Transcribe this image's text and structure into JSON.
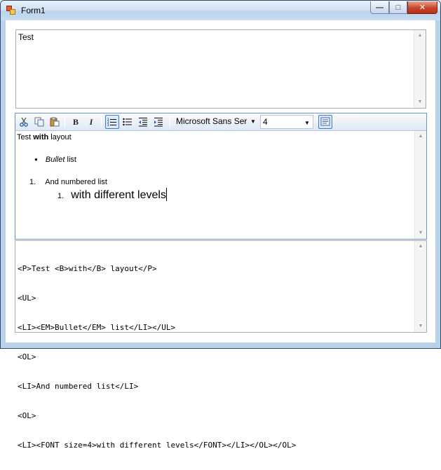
{
  "window": {
    "title": "Form1",
    "buttons": {
      "minimize": "—",
      "maximize": "□",
      "close": "✕"
    }
  },
  "top_textbox": {
    "value": "Test"
  },
  "editor": {
    "toolbar": {
      "icons": [
        "cut-icon",
        "copy-icon",
        "paste-icon",
        "bold-icon",
        "italic-icon",
        "numbered-list-icon",
        "bullet-list-icon",
        "decrease-indent-icon",
        "increase-indent-icon",
        "html-view-icon"
      ],
      "bold_label": "B",
      "italic_label": "I",
      "font_family": "Microsoft Sans Ser",
      "font_size": "4"
    },
    "content": {
      "line1_prefix": "Test ",
      "line1_bold": "with",
      "line1_suffix": " layout",
      "bullet_marker": "●",
      "bullet_em": "Bullet",
      "bullet_text": " list",
      "num1_marker": "1.",
      "num1_text": "And numbered list",
      "num2_marker": "1.",
      "num2_text": "with different levels"
    }
  },
  "html_source": {
    "lines": [
      "<P>Test <B>with</B> layout</P>",
      "<UL>",
      "<LI><EM>Bullet</EM> list</LI></UL>",
      "<OL>",
      "<LI>And numbered list</LI>",
      "<OL>",
      "<LI><FONT size=4>with different levels</FONT></LI></OL></OL>"
    ]
  }
}
